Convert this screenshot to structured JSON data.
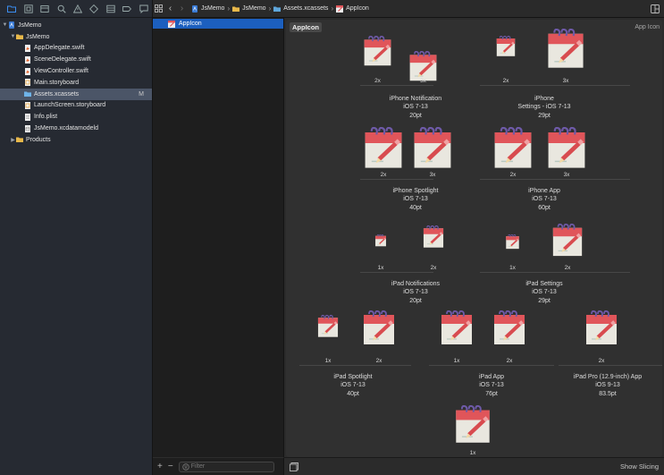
{
  "navigator": {
    "tabs": [
      "folder-icon",
      "source-control-icon",
      "symbol-icon",
      "find-icon",
      "issue-icon",
      "test-icon",
      "debug-icon",
      "breakpoint-icon",
      "report-icon"
    ],
    "tree": [
      {
        "label": "JsMemo",
        "kind": "project",
        "level": 0,
        "expanded": true
      },
      {
        "label": "JsMemo",
        "kind": "folder",
        "level": 1,
        "expanded": true
      },
      {
        "label": "AppDelegate.swift",
        "kind": "swift",
        "level": 2
      },
      {
        "label": "SceneDelegate.swift",
        "kind": "swift",
        "level": 2
      },
      {
        "label": "ViewController.swift",
        "kind": "swift",
        "level": 2
      },
      {
        "label": "Main.storyboard",
        "kind": "storyboard",
        "level": 2
      },
      {
        "label": "Assets.xcassets",
        "kind": "assets",
        "level": 2,
        "selected": true,
        "badge": "M"
      },
      {
        "label": "LaunchScreen.storyboard",
        "kind": "storyboard",
        "level": 2
      },
      {
        "label": "Info.plist",
        "kind": "plist",
        "level": 2
      },
      {
        "label": "JsMemo.xcdatamodeld",
        "kind": "datamodel",
        "level": 2
      },
      {
        "label": "Products",
        "kind": "folder",
        "level": 1,
        "expanded": false
      }
    ]
  },
  "jumpbar": {
    "crumbs": [
      {
        "label": "JsMemo",
        "kind": "project"
      },
      {
        "label": "JsMemo",
        "kind": "folder"
      },
      {
        "label": "Assets.xcassets",
        "kind": "assets-folder"
      },
      {
        "label": "AppIcon",
        "kind": "appicon"
      }
    ]
  },
  "asset_list": {
    "items": [
      {
        "label": "AppIcon",
        "selected": true
      }
    ],
    "filter_placeholder": "Filter",
    "add_label": "+",
    "remove_label": "−"
  },
  "editor": {
    "set_name": "AppIcon",
    "set_type": "App Icon",
    "groups": [
      {
        "device": "iPhone Notification",
        "os": "iOS 7-13",
        "size": "20pt",
        "slots": [
          "2x",
          "3x"
        ]
      },
      {
        "device": "iPhone\nSettings - iOS 7-13",
        "os": "",
        "size": "29pt",
        "slots": [
          "2x",
          "3x"
        ]
      },
      {
        "device": "iPhone Spotlight",
        "os": "iOS 7-13",
        "size": "40pt",
        "slots": [
          "2x",
          "3x"
        ]
      },
      {
        "device": "iPhone App",
        "os": "iOS 7-13",
        "size": "60pt",
        "slots": [
          "2x",
          "3x"
        ]
      },
      {
        "device": "iPad Notifications",
        "os": "iOS 7-13",
        "size": "20pt",
        "slots": [
          "1x",
          "2x"
        ]
      },
      {
        "device": "iPad Settings",
        "os": "iOS 7-13",
        "size": "29pt",
        "slots": [
          "1x",
          "2x"
        ]
      },
      {
        "device": "iPad Spotlight",
        "os": "iOS 7-13",
        "size": "40pt",
        "slots": [
          "1x",
          "2x"
        ]
      },
      {
        "device": "iPad App",
        "os": "iOS 7-13",
        "size": "76pt",
        "slots": [
          "1x",
          "2x"
        ]
      },
      {
        "device": "iPad Pro (12.9-inch) App",
        "os": "iOS 9-13",
        "size": "83.5pt",
        "slots": [
          "2x"
        ]
      },
      {
        "device": "",
        "os": "",
        "size": "",
        "slots": [
          "1x"
        ]
      }
    ],
    "show_slicing": "Show Slicing"
  },
  "colors": {
    "accent": "#1c5fbe",
    "icon_paper": "#e9e7df",
    "icon_header": "#e0555a",
    "icon_pencil": "#d84b4f",
    "icon_ring": "#6e5aa8"
  }
}
